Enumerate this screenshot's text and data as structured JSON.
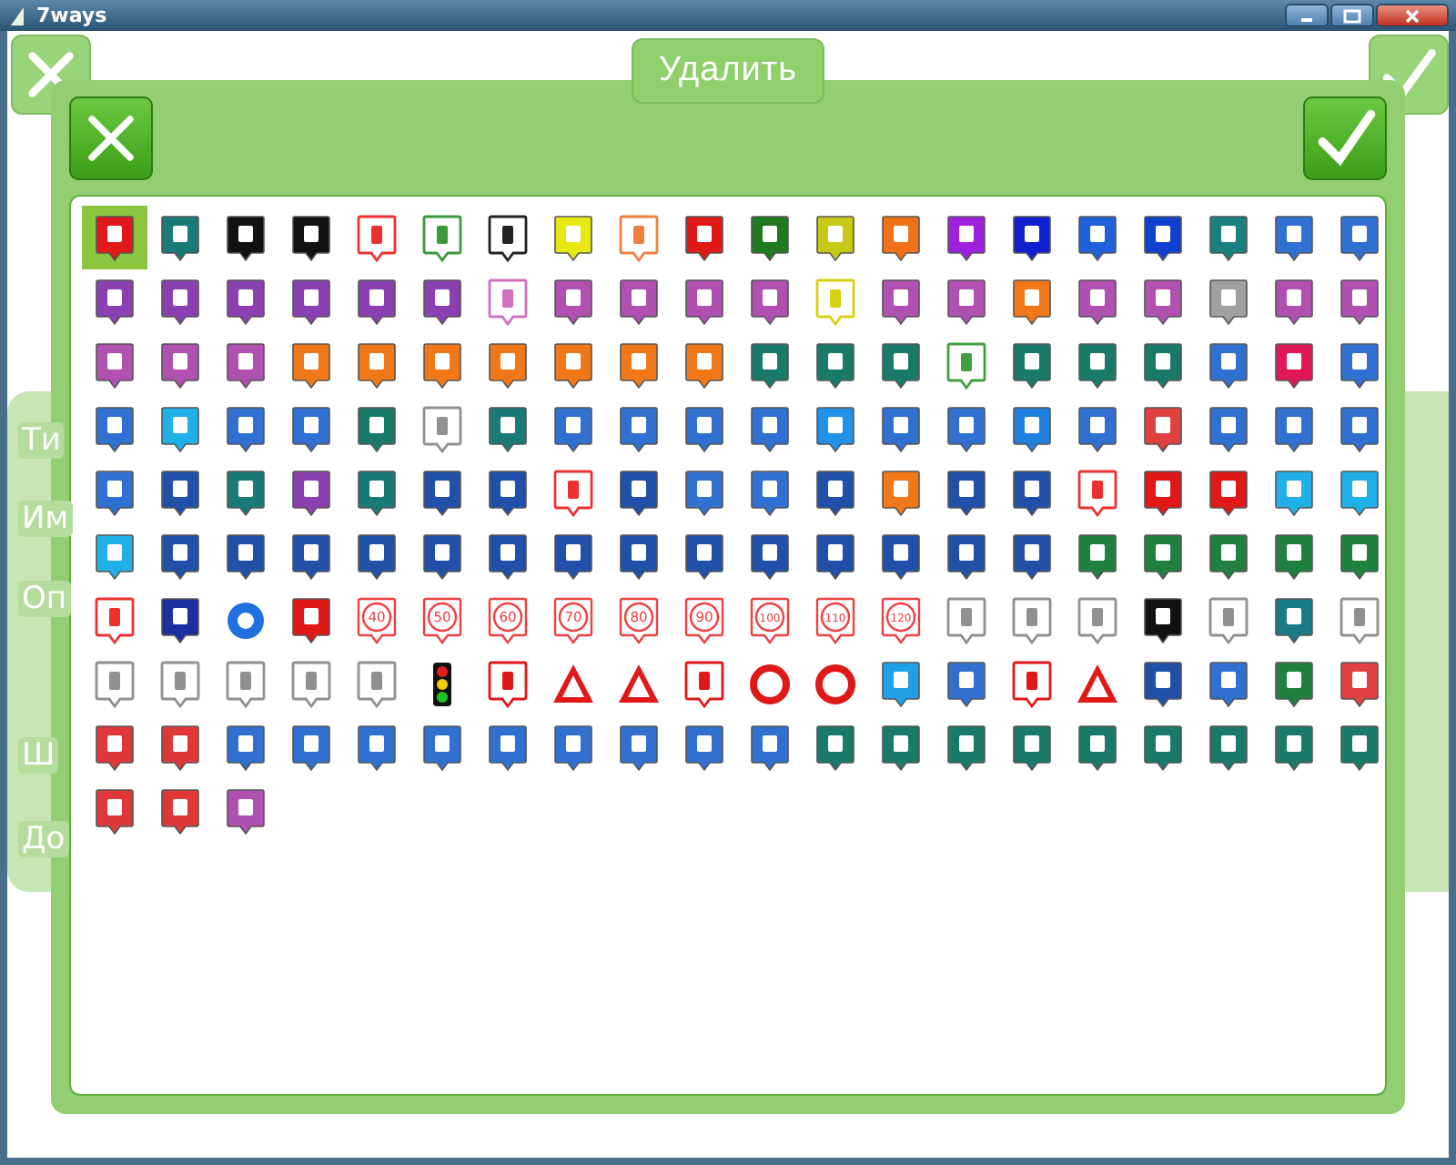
{
  "window": {
    "title": "7ways"
  },
  "background": {
    "delete_button": "Удалить",
    "labels": [
      "Ти",
      "Им",
      "Оп",
      "Ш",
      "До"
    ]
  },
  "icons": [
    {
      "kind": "pin",
      "color": "#e01818",
      "selected": true
    },
    {
      "kind": "pin",
      "color": "#1a7a78",
      "selected": false
    },
    {
      "kind": "pin",
      "color": "#111111",
      "selected": false
    },
    {
      "kind": "pin",
      "color": "#111111",
      "selected": false
    },
    {
      "kind": "outline",
      "color": "#ee3030",
      "selected": false
    },
    {
      "kind": "outline",
      "color": "#3a9a3a",
      "selected": false
    },
    {
      "kind": "outline",
      "color": "#222222",
      "selected": false
    },
    {
      "kind": "pin",
      "color": "#e8e810",
      "selected": false
    },
    {
      "kind": "outline",
      "color": "#f08040",
      "selected": false
    },
    {
      "kind": "pin",
      "color": "#e01818",
      "selected": false
    },
    {
      "kind": "pin",
      "color": "#207a20",
      "selected": false
    },
    {
      "kind": "pin",
      "color": "#c8c818",
      "selected": false
    },
    {
      "kind": "pin",
      "color": "#f07018",
      "selected": false
    },
    {
      "kind": "pin",
      "color": "#a020e0",
      "selected": false
    },
    {
      "kind": "pin",
      "color": "#1020d0",
      "selected": false
    },
    {
      "kind": "pin",
      "color": "#2060d8",
      "selected": false
    },
    {
      "kind": "pin",
      "color": "#1040d0",
      "selected": false
    },
    {
      "kind": "pin",
      "color": "#1a8080",
      "selected": false
    },
    {
      "kind": "pin",
      "color": "#3070d0",
      "selected": false
    },
    {
      "kind": "pin",
      "color": "#3070d0",
      "selected": false
    },
    {
      "kind": "pin",
      "color": "#8a40b0",
      "selected": false
    },
    {
      "kind": "pin",
      "color": "#8a40b0",
      "selected": false
    },
    {
      "kind": "pin",
      "color": "#8a40b0",
      "selected": false
    },
    {
      "kind": "pin",
      "color": "#8a40b0",
      "selected": false
    },
    {
      "kind": "pin",
      "color": "#8a40b0",
      "selected": false
    },
    {
      "kind": "pin",
      "color": "#8a40b0",
      "selected": false
    },
    {
      "kind": "outline",
      "color": "#d070c0",
      "selected": false
    },
    {
      "kind": "pin",
      "color": "#b050b0",
      "selected": false
    },
    {
      "kind": "pin",
      "color": "#b050b0",
      "selected": false
    },
    {
      "kind": "pin",
      "color": "#b050b0",
      "selected": false
    },
    {
      "kind": "pin",
      "color": "#b050b0",
      "selected": false
    },
    {
      "kind": "outline",
      "color": "#d8d010",
      "selected": false
    },
    {
      "kind": "pin",
      "color": "#b050b0",
      "selected": false
    },
    {
      "kind": "pin",
      "color": "#b050b0",
      "selected": false
    },
    {
      "kind": "pin",
      "color": "#f07818",
      "selected": false
    },
    {
      "kind": "pin",
      "color": "#b050b0",
      "selected": false
    },
    {
      "kind": "pin",
      "color": "#b050b0",
      "selected": false
    },
    {
      "kind": "pin",
      "color": "#a0a0a0",
      "selected": false
    },
    {
      "kind": "pin",
      "color": "#b050b0",
      "selected": false
    },
    {
      "kind": "pin",
      "color": "#b050b0",
      "selected": false
    },
    {
      "kind": "pin",
      "color": "#b050b0",
      "selected": false
    },
    {
      "kind": "pin",
      "color": "#b050b0",
      "selected": false
    },
    {
      "kind": "pin",
      "color": "#b050b0",
      "selected": false
    },
    {
      "kind": "pin",
      "color": "#f07818",
      "selected": false
    },
    {
      "kind": "pin",
      "color": "#f07818",
      "selected": false
    },
    {
      "kind": "pin",
      "color": "#f07818",
      "selected": false
    },
    {
      "kind": "pin",
      "color": "#f07818",
      "selected": false
    },
    {
      "kind": "pin",
      "color": "#f07818",
      "selected": false
    },
    {
      "kind": "pin",
      "color": "#f07818",
      "selected": false
    },
    {
      "kind": "pin",
      "color": "#f07818",
      "selected": false
    },
    {
      "kind": "pin",
      "color": "#1a7a68",
      "selected": false
    },
    {
      "kind": "pin",
      "color": "#1a7a68",
      "selected": false
    },
    {
      "kind": "pin",
      "color": "#1a7a68",
      "selected": false
    },
    {
      "kind": "outline",
      "color": "#40a040",
      "selected": false
    },
    {
      "kind": "pin",
      "color": "#1a7a68",
      "selected": false
    },
    {
      "kind": "pin",
      "color": "#1a7a68",
      "selected": false
    },
    {
      "kind": "pin",
      "color": "#1a7a68",
      "selected": false
    },
    {
      "kind": "pin",
      "color": "#3070d0",
      "selected": false
    },
    {
      "kind": "pin",
      "color": "#e01858",
      "selected": false
    },
    {
      "kind": "pin",
      "color": "#3070d0",
      "selected": false
    },
    {
      "kind": "pin",
      "color": "#3070d0",
      "selected": false
    },
    {
      "kind": "pin",
      "color": "#20b0e8",
      "selected": false
    },
    {
      "kind": "pin",
      "color": "#3070d0",
      "selected": false
    },
    {
      "kind": "pin",
      "color": "#3070d0",
      "selected": false
    },
    {
      "kind": "pin",
      "color": "#1a7a68",
      "selected": false
    },
    {
      "kind": "outline",
      "color": "#909090",
      "selected": false
    },
    {
      "kind": "pin",
      "color": "#1a7a78",
      "selected": false
    },
    {
      "kind": "pin",
      "color": "#3070d0",
      "selected": false
    },
    {
      "kind": "pin",
      "color": "#3070d0",
      "selected": false
    },
    {
      "kind": "pin",
      "color": "#3070d0",
      "selected": false
    },
    {
      "kind": "pin",
      "color": "#3070d0",
      "selected": false
    },
    {
      "kind": "pin",
      "color": "#2090e8",
      "selected": false
    },
    {
      "kind": "pin",
      "color": "#3070d0",
      "selected": false
    },
    {
      "kind": "pin",
      "color": "#3070d0",
      "selected": false
    },
    {
      "kind": "pin",
      "color": "#2080e0",
      "selected": false
    },
    {
      "kind": "pin",
      "color": "#3070d0",
      "selected": false
    },
    {
      "kind": "pin",
      "color": "#e04040",
      "selected": false
    },
    {
      "kind": "pin",
      "color": "#3070d0",
      "selected": false
    },
    {
      "kind": "pin",
      "color": "#3070d0",
      "selected": false
    },
    {
      "kind": "pin",
      "color": "#3070d0",
      "selected": false
    },
    {
      "kind": "pin",
      "color": "#3070d0",
      "selected": false
    },
    {
      "kind": "pin",
      "color": "#2050a8",
      "selected": false
    },
    {
      "kind": "pin",
      "color": "#1a7a78",
      "selected": false
    },
    {
      "kind": "pin",
      "color": "#8a40b0",
      "selected": false
    },
    {
      "kind": "pin",
      "color": "#1a7a78",
      "selected": false
    },
    {
      "kind": "pin",
      "color": "#2050a8",
      "selected": false
    },
    {
      "kind": "pin",
      "color": "#2050a8",
      "selected": false
    },
    {
      "kind": "outline",
      "color": "#ee3030",
      "selected": false
    },
    {
      "kind": "pin",
      "color": "#2050a8",
      "selected": false
    },
    {
      "kind": "pin",
      "color": "#3070d0",
      "selected": false
    },
    {
      "kind": "pin",
      "color": "#3070d0",
      "selected": false
    },
    {
      "kind": "pin",
      "color": "#2050a8",
      "selected": false
    },
    {
      "kind": "pin",
      "color": "#f07818",
      "selected": false
    },
    {
      "kind": "pin",
      "color": "#2050a8",
      "selected": false
    },
    {
      "kind": "pin",
      "color": "#2050a8",
      "selected": false
    },
    {
      "kind": "outline",
      "color": "#ee3030",
      "selected": false
    },
    {
      "kind": "pin",
      "color": "#e01818",
      "selected": false
    },
    {
      "kind": "pin",
      "color": "#e01818",
      "selected": false
    },
    {
      "kind": "pin",
      "color": "#20b0e8",
      "selected": false
    },
    {
      "kind": "pin",
      "color": "#20b0e8",
      "selected": false
    },
    {
      "kind": "pin",
      "color": "#20b0e8",
      "selected": false
    },
    {
      "kind": "pin",
      "color": "#2050a8",
      "selected": false
    },
    {
      "kind": "pin",
      "color": "#2050a8",
      "selected": false
    },
    {
      "kind": "pin",
      "color": "#2050a8",
      "selected": false
    },
    {
      "kind": "pin",
      "color": "#2050a8",
      "selected": false
    },
    {
      "kind": "pin",
      "color": "#2050a8",
      "selected": false
    },
    {
      "kind": "pin",
      "color": "#2050a8",
      "selected": false
    },
    {
      "kind": "pin",
      "color": "#2050a8",
      "selected": false
    },
    {
      "kind": "pin",
      "color": "#2050a8",
      "selected": false
    },
    {
      "kind": "pin",
      "color": "#2050a8",
      "selected": false
    },
    {
      "kind": "pin",
      "color": "#2050a8",
      "selected": false
    },
    {
      "kind": "pin",
      "color": "#2050a8",
      "selected": false
    },
    {
      "kind": "pin",
      "color": "#2050a8",
      "selected": false
    },
    {
      "kind": "pin",
      "color": "#2050a8",
      "selected": false
    },
    {
      "kind": "pin",
      "color": "#2050a8",
      "selected": false
    },
    {
      "kind": "pin",
      "color": "#208040",
      "selected": false
    },
    {
      "kind": "pin",
      "color": "#208040",
      "selected": false
    },
    {
      "kind": "pin",
      "color": "#208040",
      "selected": false
    },
    {
      "kind": "pin",
      "color": "#208040",
      "selected": false
    },
    {
      "kind": "pin",
      "color": "#208040",
      "selected": false
    },
    {
      "kind": "outline",
      "color": "#ee3030",
      "selected": false
    },
    {
      "kind": "pin",
      "color": "#1a30a0",
      "selected": false
    },
    {
      "kind": "round",
      "color": "#2070e0",
      "selected": false
    },
    {
      "kind": "pin",
      "color": "#e01818",
      "selected": false
    },
    {
      "kind": "limit",
      "color": "#ee4040",
      "label": "40",
      "selected": false
    },
    {
      "kind": "limit",
      "color": "#ee4040",
      "label": "50",
      "selected": false
    },
    {
      "kind": "limit",
      "color": "#ee4040",
      "label": "60",
      "selected": false
    },
    {
      "kind": "limit",
      "color": "#ee4040",
      "label": "70",
      "selected": false
    },
    {
      "kind": "limit",
      "color": "#ee4040",
      "label": "80",
      "selected": false
    },
    {
      "kind": "limit",
      "color": "#ee4040",
      "label": "90",
      "selected": false
    },
    {
      "kind": "limit",
      "color": "#ee4040",
      "label": "100",
      "selected": false
    },
    {
      "kind": "limit",
      "color": "#ee4040",
      "label": "110",
      "selected": false
    },
    {
      "kind": "limit",
      "color": "#ee4040",
      "label": "120",
      "selected": false
    },
    {
      "kind": "outline",
      "color": "#909090",
      "selected": false
    },
    {
      "kind": "outline",
      "color": "#909090",
      "selected": false
    },
    {
      "kind": "outline",
      "color": "#909090",
      "selected": false
    },
    {
      "kind": "pin",
      "color": "#111111",
      "selected": false
    },
    {
      "kind": "outline",
      "color": "#909090",
      "selected": false
    },
    {
      "kind": "pin",
      "color": "#1a7a88",
      "selected": false
    },
    {
      "kind": "outline",
      "color": "#909090",
      "selected": false
    },
    {
      "kind": "outline",
      "color": "#909090",
      "selected": false
    },
    {
      "kind": "outline",
      "color": "#909090",
      "selected": false
    },
    {
      "kind": "outline",
      "color": "#909090",
      "selected": false
    },
    {
      "kind": "outline",
      "color": "#909090",
      "selected": false
    },
    {
      "kind": "outline",
      "color": "#909090",
      "selected": false
    },
    {
      "kind": "light",
      "color": "#111111",
      "selected": false
    },
    {
      "kind": "outline",
      "color": "#e01818",
      "selected": false
    },
    {
      "kind": "triangle",
      "color": "#e01818",
      "selected": false
    },
    {
      "kind": "triangle",
      "color": "#e01818",
      "selected": false
    },
    {
      "kind": "outline",
      "color": "#e01818",
      "selected": false
    },
    {
      "kind": "ring",
      "color": "#e01818",
      "selected": false
    },
    {
      "kind": "ring",
      "color": "#e01818",
      "selected": false
    },
    {
      "kind": "pin",
      "color": "#20a0e8",
      "selected": false
    },
    {
      "kind": "pin",
      "color": "#3070d0",
      "selected": false
    },
    {
      "kind": "outline",
      "color": "#e01818",
      "selected": false
    },
    {
      "kind": "triangle",
      "color": "#e01818",
      "selected": false
    },
    {
      "kind": "pin",
      "color": "#2050a8",
      "selected": false
    },
    {
      "kind": "pin",
      "color": "#3070d0",
      "selected": false
    },
    {
      "kind": "pin",
      "color": "#208040",
      "selected": false
    },
    {
      "kind": "pin",
      "color": "#e04040",
      "selected": false
    },
    {
      "kind": "pin",
      "color": "#e03838",
      "selected": false
    },
    {
      "kind": "pin",
      "color": "#e03838",
      "selected": false
    },
    {
      "kind": "pin",
      "color": "#3070d0",
      "selected": false
    },
    {
      "kind": "pin",
      "color": "#3070d0",
      "selected": false
    },
    {
      "kind": "pin",
      "color": "#3070d0",
      "selected": false
    },
    {
      "kind": "pin",
      "color": "#3070d0",
      "selected": false
    },
    {
      "kind": "pin",
      "color": "#3070d0",
      "selected": false
    },
    {
      "kind": "pin",
      "color": "#3070d0",
      "selected": false
    },
    {
      "kind": "pin",
      "color": "#3070d0",
      "selected": false
    },
    {
      "kind": "pin",
      "color": "#3070d0",
      "selected": false
    },
    {
      "kind": "pin",
      "color": "#3070d0",
      "selected": false
    },
    {
      "kind": "pin",
      "color": "#1a7a68",
      "selected": false
    },
    {
      "kind": "pin",
      "color": "#1a7a68",
      "selected": false
    },
    {
      "kind": "pin",
      "color": "#1a7a68",
      "selected": false
    },
    {
      "kind": "pin",
      "color": "#1a7a68",
      "selected": false
    },
    {
      "kind": "pin",
      "color": "#1a7a68",
      "selected": false
    },
    {
      "kind": "pin",
      "color": "#1a7a68",
      "selected": false
    },
    {
      "kind": "pin",
      "color": "#1a7a68",
      "selected": false
    },
    {
      "kind": "pin",
      "color": "#1a7a68",
      "selected": false
    },
    {
      "kind": "pin",
      "color": "#1a7a68",
      "selected": false
    },
    {
      "kind": "pin",
      "color": "#e03838",
      "selected": false
    },
    {
      "kind": "pin",
      "color": "#e03838",
      "selected": false
    },
    {
      "kind": "pin",
      "color": "#b050b0",
      "selected": false
    }
  ]
}
